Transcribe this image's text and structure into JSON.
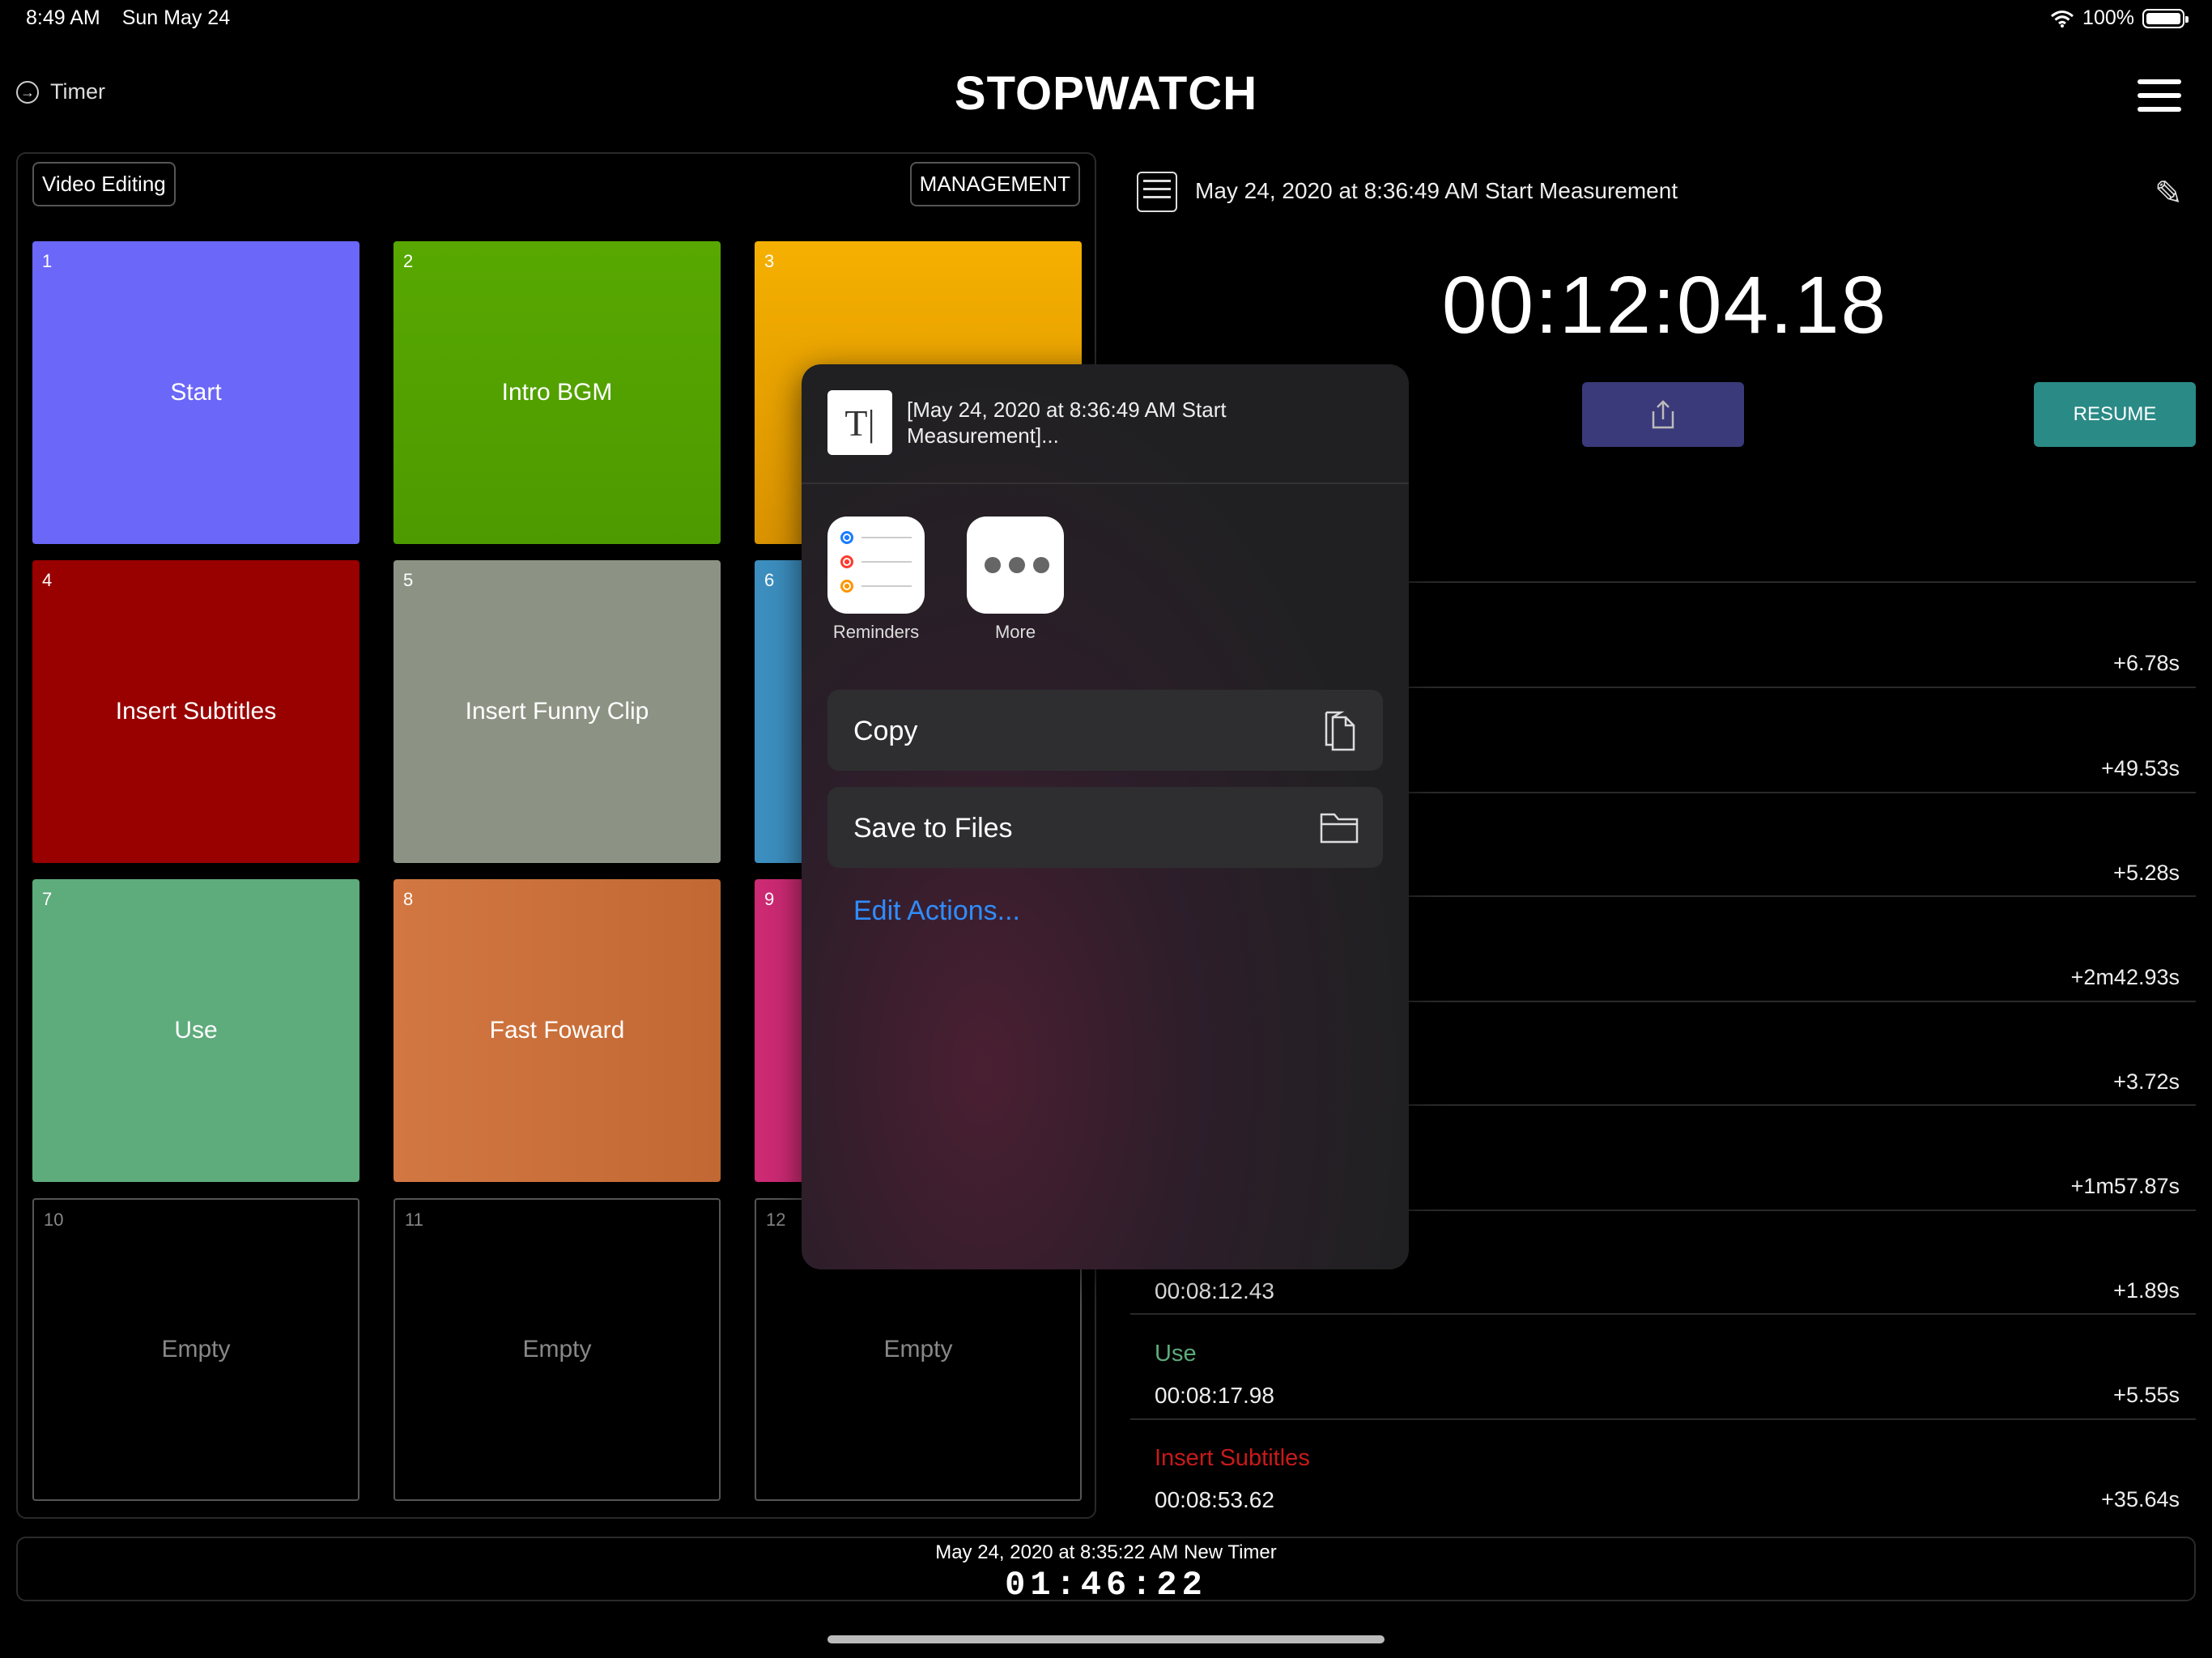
{
  "status_bar": {
    "time": "8:49 AM",
    "date": "Sun May 24",
    "battery": "100%"
  },
  "nav": {
    "back_label": "Timer",
    "title": "STOPWATCH"
  },
  "left_panel": {
    "category_label": "Video Editing",
    "management_label": "MANAGEMENT",
    "tiles": [
      {
        "num": "1",
        "label": "Start",
        "color": "#6b67f8"
      },
      {
        "num": "2",
        "label": "Intro BGM",
        "color": "#55a400"
      },
      {
        "num": "3",
        "label": "",
        "color": "#f2ac00"
      },
      {
        "num": "4",
        "label": "Insert Subtitles",
        "color": "#990000"
      },
      {
        "num": "5",
        "label": "Insert Funny Clip",
        "color": "#8d9384"
      },
      {
        "num": "6",
        "label": "",
        "color": "#3c8ebf"
      },
      {
        "num": "7",
        "label": "Use",
        "color": "#5eab7c"
      },
      {
        "num": "8",
        "label": "Fast Foward",
        "color": "#d07340"
      },
      {
        "num": "9",
        "label": "",
        "color": "#cc2a73"
      },
      {
        "num": "10",
        "label": "Empty",
        "color": ""
      },
      {
        "num": "11",
        "label": "Empty",
        "color": ""
      },
      {
        "num": "12",
        "label": "Empty",
        "color": ""
      }
    ]
  },
  "measurement": {
    "title": "May 24, 2020 at 8:36:49 AM Start Measurement",
    "elapsed": "00:12:04.18",
    "resume_label": "RESUME"
  },
  "laps": [
    {
      "name": "",
      "time": "",
      "delta": "+6.78s",
      "color": ""
    },
    {
      "name": "",
      "time": "",
      "delta": "+49.53s",
      "color": ""
    },
    {
      "name": "",
      "time": "",
      "delta": "+5.28s",
      "color": ""
    },
    {
      "name": "",
      "time": "",
      "delta": "+2m42.93s",
      "color": ""
    },
    {
      "name": "",
      "time": "",
      "delta": "+3.72s",
      "color": ""
    },
    {
      "name": "",
      "time": "",
      "delta": "+1m57.87s",
      "color": ""
    },
    {
      "name": "",
      "time": "00:08:12.43",
      "delta": "+1.89s",
      "color": ""
    },
    {
      "name": "Use",
      "time": "00:08:17.98",
      "delta": "+5.55s",
      "color": "#5eab7c"
    },
    {
      "name": "Insert Subtitles",
      "time": "00:08:53.62",
      "delta": "+35.64s",
      "color": "#c81a1a"
    }
  ],
  "share_sheet": {
    "doc_preview": "[May 24, 2020 at 8:36:49 AM Start Measurement]...",
    "apps": [
      {
        "label": "Reminders",
        "icon": "reminders-icon"
      },
      {
        "label": "More",
        "icon": "more-icon"
      }
    ],
    "actions": [
      {
        "label": "Copy",
        "icon": "copy-icon"
      },
      {
        "label": "Save to Files",
        "icon": "folder-icon"
      }
    ],
    "edit_actions": "Edit Actions..."
  },
  "bottom_timer": {
    "subtitle": "May 24, 2020 at 8:35:22 AM New Timer",
    "time": "01:46:22"
  }
}
